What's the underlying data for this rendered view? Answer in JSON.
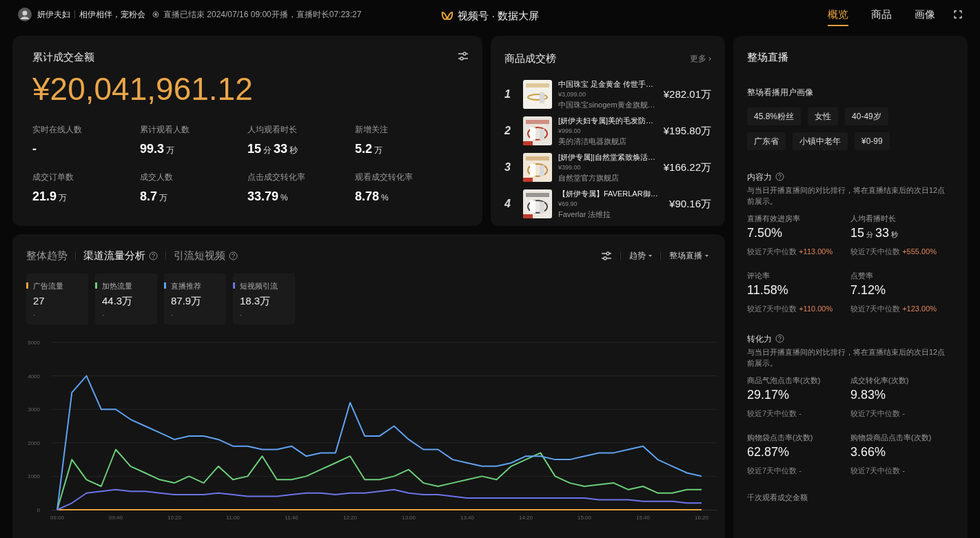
{
  "header": {
    "streamer": "妍伊夫妇",
    "slogan": "相伊相伴，宠粉会",
    "status": "直播已结束 2024/07/16 09:00开播，直播时长07:23:27",
    "title": "视频号 · 数据大屏",
    "tabs": [
      {
        "label": "概览",
        "selected": true
      },
      {
        "label": "商品",
        "selected": false
      },
      {
        "label": "画像",
        "selected": false
      }
    ]
  },
  "gmv_card": {
    "title": "累计成交金额",
    "amount": "¥20,041,961.12",
    "metrics": [
      {
        "label": "实时在线人数",
        "value_parts": [
          "-"
        ]
      },
      {
        "label": "累计观看人数",
        "value_parts": [
          "99.3",
          "万"
        ]
      },
      {
        "label": "人均观看时长",
        "value_parts": [
          "15",
          "分",
          "33",
          "秒"
        ]
      },
      {
        "label": "新增关注",
        "value_parts": [
          "5.2",
          "万"
        ]
      },
      {
        "label": "成交订单数",
        "value_parts": [
          "21.9",
          "万"
        ]
      },
      {
        "label": "成交人数",
        "value_parts": [
          "8.7",
          "万"
        ]
      },
      {
        "label": "点击成交转化率",
        "value_parts": [
          "33.79",
          "%"
        ]
      },
      {
        "label": "观看成交转化率",
        "value_parts": [
          "8.78",
          "%"
        ]
      }
    ]
  },
  "ranking": {
    "title": "商品成交榜",
    "more": "更多 ›",
    "items": [
      {
        "rank": "1",
        "name": "中国珠宝 足金黄金 传世手…",
        "price": "¥3,099.00",
        "shop": "中国珠宝sinogem黄金旗舰…",
        "amount": "¥282.01万"
      },
      {
        "rank": "2",
        "name": "[妍伊夫妇专属]美的毛发防…",
        "price": "¥999.00",
        "shop": "美的清洁电器旗舰店",
        "amount": "¥195.80万"
      },
      {
        "rank": "3",
        "name": "[妍伊专属]|自然堂紧致焕活…",
        "price": "¥399.00",
        "shop": "自然堂官方旗舰店",
        "amount": "¥166.22万"
      },
      {
        "rank": "4",
        "name": "【妍伊专属】FAVERLAR御…",
        "price": "¥69.90",
        "shop": "Faverlar 法维拉",
        "amount": "¥90.16万"
      }
    ]
  },
  "traffic": {
    "tabs": [
      {
        "label": "整体趋势",
        "selected": false,
        "help": false
      },
      {
        "label": "渠道流量分析",
        "selected": true,
        "help": true
      },
      {
        "label": "引流短视频",
        "selected": false,
        "help": true
      }
    ],
    "controls": [
      "趋势",
      "整场直播"
    ],
    "channels": [
      {
        "name": "广告流量",
        "value": "27",
        "compare": "-",
        "color": "#e8a33c"
      },
      {
        "name": "加热流量",
        "value": "44.3万",
        "compare": "-",
        "color": "#6ccf7a"
      },
      {
        "name": "直播推荐",
        "value": "87.9万",
        "compare": "-",
        "color": "#5fa3f2"
      },
      {
        "name": "短视频引流",
        "value": "18.3万",
        "compare": "-",
        "color": "#6b74e8"
      }
    ],
    "chart_data": {
      "type": "line",
      "categories": [
        "09:00",
        null,
        null,
        null,
        "09:40",
        null,
        null,
        null,
        "10:20",
        null,
        null,
        null,
        "11:00",
        null,
        null,
        null,
        "11:40",
        null,
        null,
        null,
        "12:20",
        null,
        null,
        null,
        "13:00",
        null,
        null,
        null,
        "13:40",
        null,
        null,
        null,
        "14:20",
        null,
        null,
        null,
        "15:00",
        null,
        null,
        null,
        "15:40",
        null,
        null,
        null,
        "16:20"
      ],
      "yticks": [
        0,
        1000,
        2000,
        3000,
        4000,
        5000
      ],
      "ylim": [
        0,
        5000
      ],
      "grid": true,
      "series": [
        {
          "color": "#e8a33c",
          "values": [
            0,
            0,
            0,
            0,
            0,
            0,
            0,
            0,
            0,
            0,
            0,
            0,
            0,
            0,
            0,
            0,
            0,
            0,
            0,
            0,
            0,
            0,
            0,
            0,
            0,
            0,
            0,
            0,
            0,
            0,
            0,
            0,
            0,
            0,
            0,
            0,
            0,
            0,
            0,
            0,
            0,
            0,
            0,
            0,
            0
          ]
        },
        {
          "color": "#6ccf7a",
          "values": [
            0,
            1500,
            900,
            700,
            1800,
            1300,
            1100,
            900,
            800,
            1000,
            800,
            1300,
            900,
            1000,
            1600,
            900,
            900,
            1000,
            1200,
            1400,
            1600,
            900,
            900,
            1000,
            1200,
            800,
            700,
            800,
            900,
            1000,
            900,
            1300,
            1500,
            1700,
            1000,
            800,
            700,
            750,
            800,
            600,
            700,
            500,
            500,
            600,
            600
          ]
        },
        {
          "color": "#5fa3f2",
          "values": [
            0,
            3500,
            4000,
            3000,
            3000,
            2700,
            2500,
            2300,
            2100,
            2200,
            2200,
            2100,
            1900,
            1900,
            1800,
            1800,
            1900,
            1600,
            1700,
            1700,
            3200,
            2200,
            2200,
            2500,
            2100,
            1800,
            1800,
            1500,
            1400,
            1300,
            1300,
            1400,
            1600,
            1600,
            1500,
            1500,
            1600,
            1700,
            1700,
            1800,
            1900,
            1500,
            1300,
            1100,
            1000
          ]
        },
        {
          "color": "#6b74e8",
          "values": [
            0,
            200,
            500,
            550,
            600,
            550,
            550,
            500,
            450,
            450,
            450,
            500,
            450,
            400,
            400,
            400,
            450,
            500,
            500,
            450,
            500,
            500,
            550,
            600,
            500,
            450,
            450,
            400,
            350,
            350,
            350,
            350,
            350,
            350,
            350,
            350,
            350,
            300,
            300,
            300,
            250,
            250,
            250,
            200,
            200
          ]
        }
      ]
    }
  },
  "live": {
    "title": "整场直播",
    "portrait_title": "整场看播用户画像",
    "tags": [
      "45.8%粉丝",
      "女性",
      "40-49岁",
      "广东省",
      "小镇中老年",
      "¥0-99"
    ],
    "sections": [
      {
        "title": "内容力",
        "note": "与当日开播直播间的对比排行，将在直播结束后的次日12点前展示。",
        "metrics": [
          {
            "label": "直播有效进房率",
            "value_parts": [
              "7.50%"
            ],
            "compare": "较近7天中位数",
            "change": "+113.00%",
            "up": true
          },
          {
            "label": "人均看播时长",
            "value_parts": [
              "15",
              "分",
              "33",
              "秒"
            ],
            "compare": "较近7天中位数",
            "change": "+555.00%",
            "up": true
          },
          {
            "label": "评论率",
            "value_parts": [
              "11.58%"
            ],
            "compare": "较近7天中位数",
            "change": "+110.00%",
            "up": true
          },
          {
            "label": "点赞率",
            "value_parts": [
              "7.12%"
            ],
            "compare": "较近7天中位数",
            "change": "+123.00%",
            "up": true
          }
        ]
      },
      {
        "title": "转化力",
        "note": "与当日开播直播间的对比排行，将在直播结束后的次日12点前展示。",
        "metrics": [
          {
            "label": "商品气泡点击率(次数)",
            "value_parts": [
              "29.17%"
            ],
            "compare": "较近7天中位数",
            "change": "-",
            "up": false
          },
          {
            "label": "成交转化率(次数)",
            "value_parts": [
              "9.83%"
            ],
            "compare": "较近7天中位数",
            "change": "-",
            "up": false
          },
          {
            "label": "购物袋点击率(次数)",
            "value_parts": [
              "62.87%"
            ],
            "compare": "较近7天中位数",
            "change": "-",
            "up": false
          },
          {
            "label": "购物袋商品点击率(次数)",
            "value_parts": [
              "3.66%"
            ],
            "compare": "较近7天中位数",
            "change": "-",
            "up": false
          }
        ]
      }
    ],
    "next_label": "千次观看成交金额"
  }
}
